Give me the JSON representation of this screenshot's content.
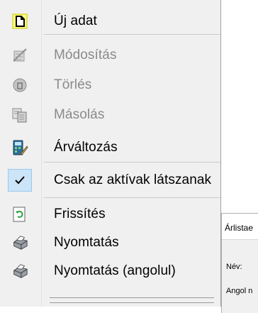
{
  "menu": {
    "items": [
      {
        "label": "Új adat",
        "icon": "new-document-icon",
        "disabled": false
      },
      {
        "label": "Módosítás",
        "icon": "edit-icon",
        "disabled": true
      },
      {
        "label": "Törlés",
        "icon": "delete-icon",
        "disabled": true
      },
      {
        "label": "Másolás",
        "icon": "copy-icon",
        "disabled": true
      },
      {
        "label": "Árváltozás",
        "icon": "price-change-icon",
        "disabled": false
      },
      {
        "label": "Csak az aktívak látszanak",
        "icon": "check-icon",
        "checked": true
      },
      {
        "label": "Frissítés",
        "icon": "refresh-icon",
        "disabled": false
      },
      {
        "label": "Nyomtatás",
        "icon": "printer-icon",
        "disabled": false
      },
      {
        "label": "Nyomtatás (angolul)",
        "icon": "printer-icon",
        "disabled": false
      }
    ]
  },
  "dialog": {
    "title": "Árlistae",
    "name_label": "Név:",
    "english_label": "Angol n"
  },
  "colors": {
    "menu_bg": "#f0f0f0",
    "disabled_text": "#8a8a8a",
    "check_highlight": "#cce4f7"
  }
}
